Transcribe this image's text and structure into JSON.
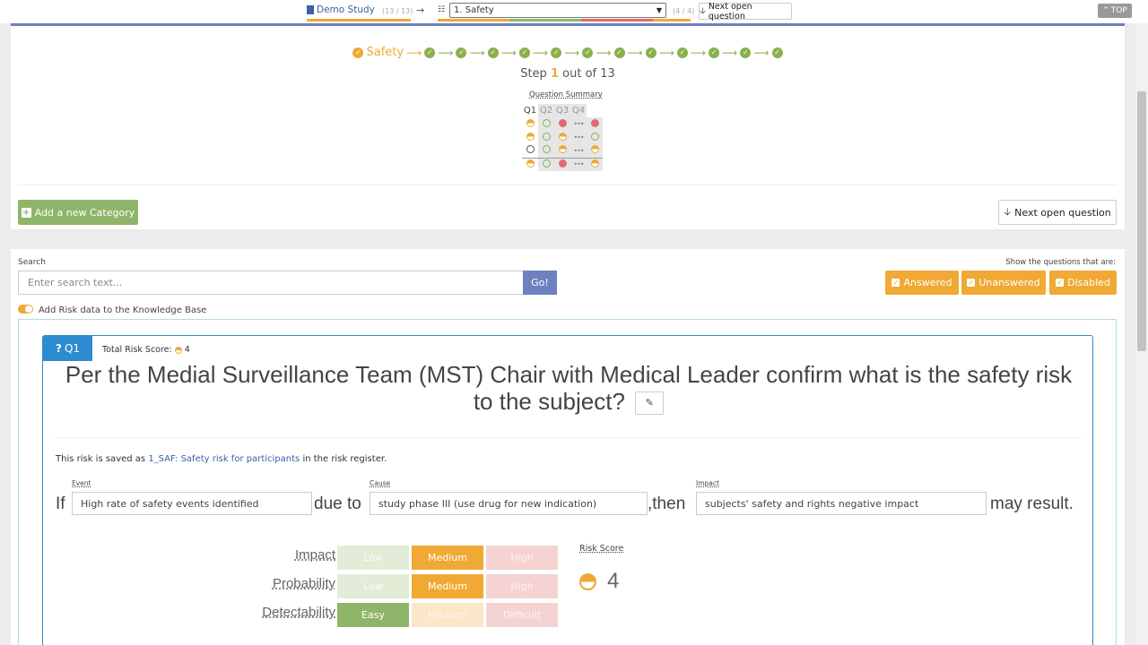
{
  "topbar": {
    "study_label": "Demo Study",
    "study_count": "(13 / 13)",
    "arrow": "→",
    "category_selected": "1. Safety",
    "category_count": "(4 / 4)",
    "next_open_label": "Next open question",
    "top_label": "TOP",
    "category_bar_colors": [
      "#f0a935",
      "#8fb56a",
      "#e36a6a",
      "#f0a935"
    ]
  },
  "progress": {
    "current_label": "Safety",
    "steps_total": 13,
    "step_prefix": "Step",
    "step_current": "1",
    "step_suffix": "out of 13"
  },
  "question_summary": {
    "title": "Question Summary",
    "headers": [
      "Q1",
      "Q2",
      "Q3",
      "Q4"
    ],
    "rows": [
      [
        "h",
        "e",
        "r",
        "…",
        "r"
      ],
      [
        "h",
        "e",
        "ho",
        "…",
        "e"
      ],
      [
        "dk",
        "e",
        "ho",
        "…",
        "ho"
      ],
      [
        "h",
        "e",
        "r",
        "…",
        "ho"
      ]
    ]
  },
  "actions": {
    "add_category_label": "Add a new Category",
    "next_open_label": "Next open question"
  },
  "search": {
    "label": "Search",
    "placeholder": "Enter search text...",
    "go_label": "Go!"
  },
  "filters": {
    "label": "Show the questions that are:",
    "answered": "Answered",
    "unanswered": "Unanswered",
    "disabled": "Disabled"
  },
  "toggle_label": "Add Risk data to the Knowledge Base",
  "question": {
    "tag": "Q1",
    "total_risk_label": "Total Risk Score:",
    "total_risk_value": "4",
    "text": "Per the Medial Surveillance Team (MST) Chair with Medical Leader confirm what is the safety risk to the subject?",
    "saved_prefix": "This risk is saved as",
    "saved_link": "1_SAF: Safety risk for participants",
    "saved_suffix": "in the risk register.",
    "if_word": "If",
    "event_label": "Event",
    "event_value": "High rate of safety events identified",
    "due_to": "due to",
    "cause_label": "Cause",
    "cause_value": "study phase III (use drug for new indication)",
    "then_word": ",then",
    "impact_label": "Impact",
    "impact_value": "subjects' safety and rights negative impact",
    "may_result": "may result."
  },
  "ratings": {
    "impact": {
      "label": "Impact",
      "options": [
        "Low",
        "Medium",
        "High"
      ],
      "selected": "Medium"
    },
    "probability": {
      "label": "Probability",
      "options": [
        "Low",
        "Medium",
        "High"
      ],
      "selected": "Medium"
    },
    "detectability": {
      "label": "Detectability",
      "options": [
        "Easy",
        "Medium",
        "Difficult"
      ],
      "selected": "Easy"
    }
  },
  "risk_score": {
    "label": "Risk Score",
    "value": "4"
  },
  "colors": {
    "accent_blue": "#6d80bf",
    "accent_orange": "#f0a935",
    "accent_green": "#8fb56a",
    "accent_red": "#e36a6a",
    "card_blue": "#2d8ccf"
  }
}
